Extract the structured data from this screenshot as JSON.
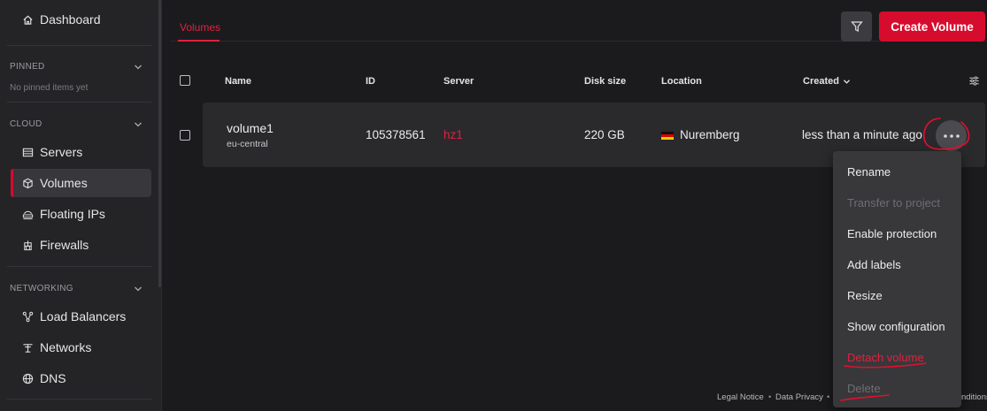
{
  "sidebar": {
    "dashboard": "Dashboard",
    "pinned": {
      "title": "PINNED",
      "empty": "No pinned items yet"
    },
    "cloud": {
      "title": "CLOUD",
      "items": [
        {
          "label": "Servers"
        },
        {
          "label": "Volumes"
        },
        {
          "label": "Floating IPs"
        },
        {
          "label": "Firewalls"
        }
      ]
    },
    "networking": {
      "title": "NETWORKING",
      "items": [
        {
          "label": "Load Balancers"
        },
        {
          "label": "Networks"
        },
        {
          "label": "DNS"
        }
      ]
    }
  },
  "tabs": {
    "volumes": "Volumes"
  },
  "toolbar": {
    "create_label": "Create Volume"
  },
  "table": {
    "headers": {
      "name": "Name",
      "id": "ID",
      "server": "Server",
      "disk_size": "Disk size",
      "location": "Location",
      "created": "Created"
    },
    "rows": [
      {
        "name": "volume1",
        "region": "eu-central",
        "id": "105378561",
        "server": "hz1",
        "disk_size": "220 GB",
        "location": "Nuremberg",
        "created": "less than a minute ago"
      }
    ]
  },
  "context_menu": {
    "items": [
      {
        "label": "Rename"
      },
      {
        "label": "Transfer to project"
      },
      {
        "label": "Enable protection"
      },
      {
        "label": "Add labels"
      },
      {
        "label": "Resize"
      },
      {
        "label": "Show configuration"
      },
      {
        "label": "Detach volume"
      },
      {
        "label": "Delete"
      }
    ]
  },
  "footer": {
    "legal": "Legal Notice",
    "sep1": "•",
    "privacy": "Data Privacy",
    "sep2": "•",
    "conditions": "nditions"
  },
  "colors": {
    "accent": "#d50c2d",
    "annotation": "#e0102f"
  }
}
